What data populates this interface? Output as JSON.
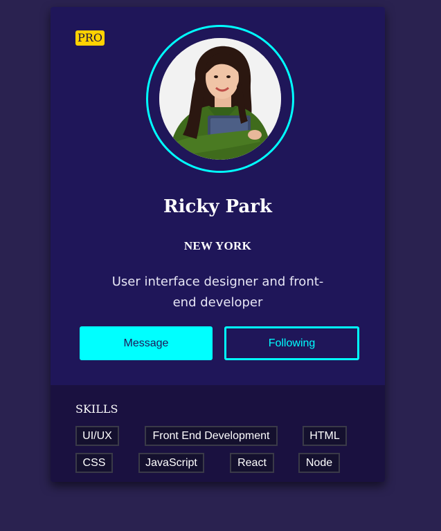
{
  "card": {
    "badge": "PRO",
    "name": "Ricky Park",
    "location": "NEW YORK",
    "bio": "User interface designer and front-end developer",
    "buttons": {
      "message": "Message",
      "following": "Following"
    },
    "accent_color": "#00ffff",
    "badge_color": "#ffd200"
  },
  "skills": {
    "title": "SKILLS",
    "items": [
      "UI/UX",
      "Front End Development",
      "HTML",
      "CSS",
      "JavaScript",
      "React",
      "Node"
    ]
  }
}
